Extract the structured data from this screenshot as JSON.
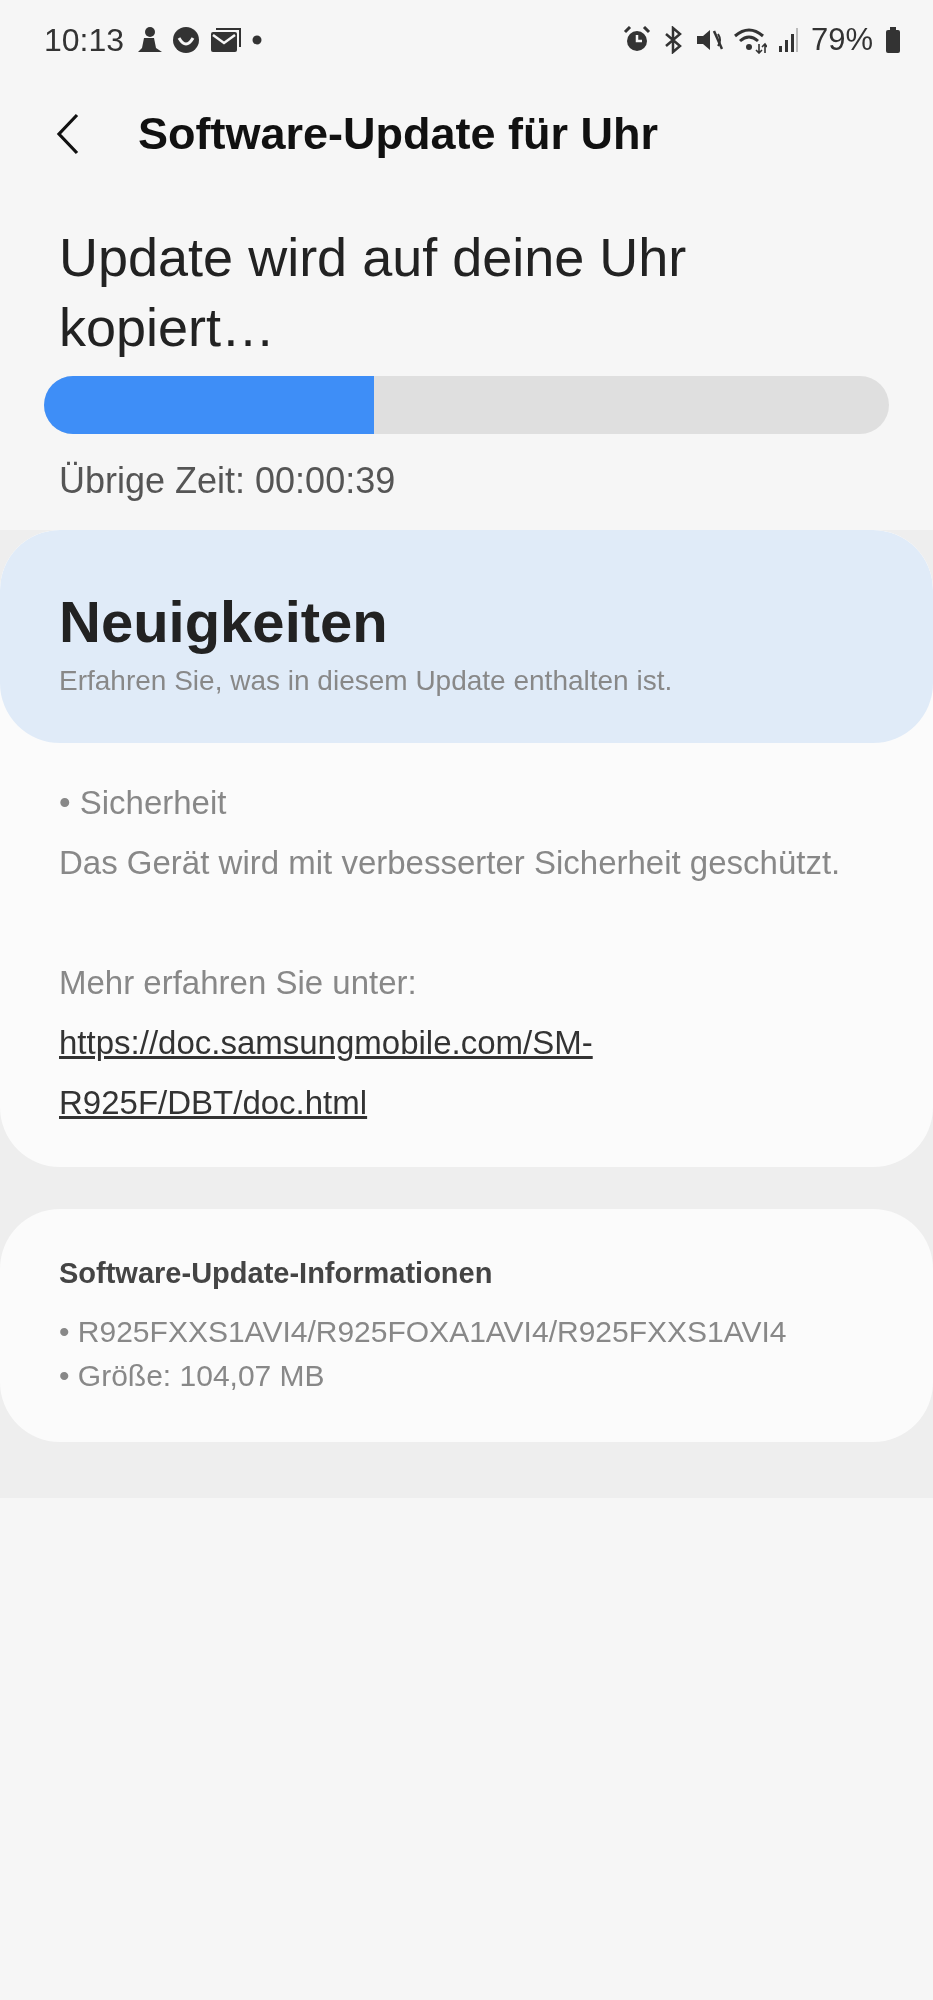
{
  "status_bar": {
    "time": "10:13",
    "battery": "79%"
  },
  "header": {
    "title": "Software-Update für Uhr"
  },
  "progress": {
    "heading": "Update wird auf deine Uhr kopiert…",
    "level": 0.39,
    "remaining": "Übrige Zeit: 00:00:39"
  },
  "whats_new": {
    "title": "Neuigkeiten",
    "subtitle": "Erfahren Sie, was in diesem Update enthalten ist.",
    "notes": [
      {
        "kind": "text",
        "text": "• Sicherheit"
      },
      {
        "kind": "text",
        "text": "Das Gerät wird mit verbesserter Sicherheit geschützt."
      },
      {
        "kind": "spacer"
      },
      {
        "kind": "text",
        "text": "Mehr erfahren Sie unter:"
      },
      {
        "kind": "link",
        "text": "https://doc.samsungmobile.com/SM-R925F/DBT/doc.html"
      }
    ]
  },
  "info": {
    "title": "Software-Update-Informationen",
    "items": [
      "• R925FXXS1AVI4/R925FOXA1AVI4/R925FXXS1AVI4",
      "• Größe: 104,07 MB"
    ]
  }
}
